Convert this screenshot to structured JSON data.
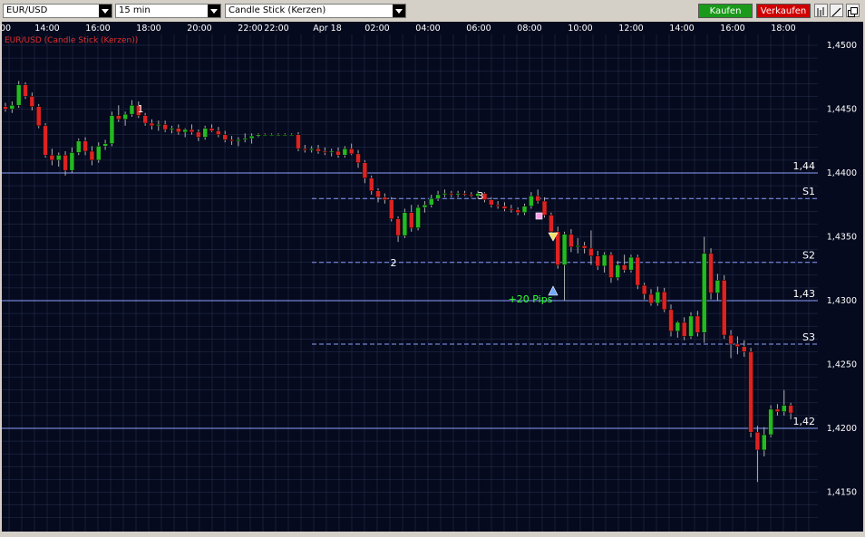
{
  "toolbar": {
    "symbol": "EUR/USD",
    "interval": "15 min",
    "chart_style": "Candle Stick (Kerzen)",
    "buy_label": "Kaufen",
    "sell_label": "Verkaufen",
    "colors": {
      "buy": "#1a9a1a",
      "sell": "#d00000"
    }
  },
  "chart_data": {
    "type": "candlestick",
    "title": "EUR/USD (Candle Stick (Kerzen))",
    "x_tick_labels": [
      "00",
      "14:00",
      "16:00",
      "18:00",
      "20:00",
      "22:00",
      "22:00",
      "Apr 18",
      "02:00",
      "04:00",
      "06:00",
      "08:00",
      "10:00",
      "12:00",
      "14:00",
      "16:00",
      "18:00"
    ],
    "y_tick_labels": [
      "1,4500",
      "1,4450",
      "1,4400",
      "1,4350",
      "1,4300",
      "1,4250",
      "1,4200",
      "1,4150"
    ],
    "ylim": [
      1.413,
      1.452
    ],
    "grid": true,
    "colors": {
      "background": "#050a1e",
      "grid": "#2a3350",
      "up": "#22bb22",
      "down": "#dd2222",
      "level_line": "#8aa0ff",
      "pivot_line": "#8aa0ff",
      "pips_text": "#33ff33"
    },
    "horizontal_levels": [
      {
        "label": "1,44",
        "value": 1.44
      },
      {
        "label": "1,43",
        "value": 1.43
      },
      {
        "label": "1,42",
        "value": 1.42
      }
    ],
    "pivot_levels": [
      {
        "label": "S1",
        "value": 1.438
      },
      {
        "label": "S2",
        "value": 1.433
      },
      {
        "label": "S3",
        "value": 1.4266
      }
    ],
    "annotations": [
      {
        "text": "1",
        "x": "18:00",
        "y": 1.4464
      },
      {
        "text": "2",
        "x": "03:00",
        "y": 1.4343
      },
      {
        "text": "3",
        "x": "06:00",
        "y": 1.4395
      },
      {
        "text": "+20 Pips",
        "x": "09:15",
        "y": 1.4314
      }
    ],
    "candles": [
      [
        1.4452,
        1.4455,
        1.4448,
        1.445
      ],
      [
        1.445,
        1.4456,
        1.4447,
        1.4453
      ],
      [
        1.4453,
        1.4472,
        1.4451,
        1.4469
      ],
      [
        1.4469,
        1.4471,
        1.4458,
        1.446
      ],
      [
        1.446,
        1.4463,
        1.4449,
        1.4452
      ],
      [
        1.4452,
        1.4454,
        1.4435,
        1.4437
      ],
      [
        1.4437,
        1.4439,
        1.4412,
        1.4414
      ],
      [
        1.4414,
        1.4419,
        1.4406,
        1.441
      ],
      [
        1.441,
        1.4416,
        1.4405,
        1.4414
      ],
      [
        1.4414,
        1.4417,
        1.4398,
        1.4402
      ],
      [
        1.4402,
        1.442,
        1.44,
        1.4416
      ],
      [
        1.4416,
        1.4427,
        1.4414,
        1.4425
      ],
      [
        1.4425,
        1.4428,
        1.4414,
        1.4417
      ],
      [
        1.4417,
        1.4421,
        1.4406,
        1.441
      ],
      [
        1.441,
        1.4424,
        1.4408,
        1.4421
      ],
      [
        1.4421,
        1.4426,
        1.4418,
        1.4423
      ],
      [
        1.4423,
        1.4448,
        1.4421,
        1.4445
      ],
      [
        1.4445,
        1.4453,
        1.444,
        1.4442
      ],
      [
        1.4442,
        1.4448,
        1.4437,
        1.4446
      ],
      [
        1.4446,
        1.4457,
        1.4444,
        1.4453
      ],
      [
        1.4453,
        1.4456,
        1.4443,
        1.4445
      ],
      [
        1.4445,
        1.4447,
        1.4437,
        1.4439
      ],
      [
        1.4439,
        1.4442,
        1.4434,
        1.4437
      ],
      [
        1.4437,
        1.4441,
        1.4433,
        1.4438
      ],
      [
        1.4438,
        1.4441,
        1.4432,
        1.4434
      ],
      [
        1.4434,
        1.4437,
        1.4431,
        1.4435
      ],
      [
        1.4435,
        1.4438,
        1.443,
        1.4432
      ],
      [
        1.4432,
        1.4435,
        1.4428,
        1.4434
      ],
      [
        1.4434,
        1.4438,
        1.443,
        1.4432
      ],
      [
        1.4432,
        1.4434,
        1.4425,
        1.4428
      ],
      [
        1.4428,
        1.4437,
        1.4426,
        1.4435
      ],
      [
        1.4435,
        1.4438,
        1.4432,
        1.4433
      ],
      [
        1.4433,
        1.4436,
        1.4428,
        1.443
      ],
      [
        1.443,
        1.4433,
        1.4424,
        1.4426
      ],
      [
        1.4426,
        1.4429,
        1.4422,
        1.4425
      ],
      [
        1.4425,
        1.4428,
        1.4421,
        1.4426
      ],
      [
        1.4426,
        1.4431,
        1.4424,
        1.4427
      ],
      [
        1.4427,
        1.4431,
        1.4423,
        1.4429
      ],
      [
        1.4429,
        1.4431,
        1.4428,
        1.443
      ],
      [
        1.443,
        1.4431,
        1.4429,
        1.443
      ],
      [
        1.443,
        1.4431,
        1.4429,
        1.443
      ],
      [
        1.443,
        1.4431,
        1.4429,
        1.443
      ],
      [
        1.443,
        1.4431,
        1.4429,
        1.443
      ],
      [
        1.443,
        1.4431,
        1.4429,
        1.443
      ],
      [
        1.443,
        1.4432,
        1.4417,
        1.4419
      ],
      [
        1.4419,
        1.4422,
        1.4416,
        1.4418
      ],
      [
        1.4418,
        1.4421,
        1.4416,
        1.4419
      ],
      [
        1.4419,
        1.4422,
        1.4415,
        1.4417
      ],
      [
        1.4417,
        1.442,
        1.4414,
        1.4416
      ],
      [
        1.4416,
        1.4419,
        1.4413,
        1.4417
      ],
      [
        1.4417,
        1.442,
        1.4412,
        1.4414
      ],
      [
        1.4414,
        1.4421,
        1.4412,
        1.4419
      ],
      [
        1.4419,
        1.4423,
        1.4414,
        1.4415
      ],
      [
        1.4415,
        1.4418,
        1.4404,
        1.4408
      ],
      [
        1.4408,
        1.441,
        1.4392,
        1.4396
      ],
      [
        1.4396,
        1.4398,
        1.4383,
        1.4386
      ],
      [
        1.4386,
        1.4388,
        1.4377,
        1.4381
      ],
      [
        1.4381,
        1.4384,
        1.4376,
        1.4379
      ],
      [
        1.4379,
        1.4381,
        1.4362,
        1.4364
      ],
      [
        1.4364,
        1.4366,
        1.4346,
        1.4351
      ],
      [
        1.4351,
        1.4372,
        1.4349,
        1.4369
      ],
      [
        1.4369,
        1.4375,
        1.4354,
        1.4357
      ],
      [
        1.4357,
        1.4375,
        1.4355,
        1.4373
      ],
      [
        1.4373,
        1.4378,
        1.4369,
        1.4375
      ],
      [
        1.4375,
        1.4383,
        1.4373,
        1.438
      ],
      [
        1.438,
        1.4386,
        1.4378,
        1.4383
      ],
      [
        1.4383,
        1.4387,
        1.4381,
        1.4384
      ],
      [
        1.4384,
        1.4386,
        1.4381,
        1.4383
      ],
      [
        1.4383,
        1.4386,
        1.4381,
        1.4384
      ],
      [
        1.4384,
        1.4386,
        1.4382,
        1.4383
      ],
      [
        1.4383,
        1.4385,
        1.4381,
        1.4382
      ],
      [
        1.4382,
        1.4386,
        1.438,
        1.4384
      ],
      [
        1.4384,
        1.4385,
        1.4377,
        1.4379
      ],
      [
        1.4379,
        1.4381,
        1.4373,
        1.4375
      ],
      [
        1.4375,
        1.4378,
        1.4372,
        1.4374
      ],
      [
        1.4374,
        1.4377,
        1.437,
        1.4372
      ],
      [
        1.4372,
        1.4375,
        1.4369,
        1.4371
      ],
      [
        1.4371,
        1.4373,
        1.4367,
        1.4369
      ],
      [
        1.4369,
        1.4376,
        1.4367,
        1.4374
      ],
      [
        1.4374,
        1.4385,
        1.4372,
        1.4382
      ],
      [
        1.4382,
        1.4387,
        1.4376,
        1.4378
      ],
      [
        1.4378,
        1.4381,
        1.4365,
        1.4367
      ],
      [
        1.4367,
        1.4369,
        1.4352,
        1.4354
      ],
      [
        1.4354,
        1.4358,
        1.4325,
        1.4328
      ],
      [
        1.4328,
        1.4354,
        1.43,
        1.4352
      ],
      [
        1.4352,
        1.4356,
        1.4338,
        1.4342
      ],
      [
        1.4342,
        1.4349,
        1.4337,
        1.4343
      ],
      [
        1.4343,
        1.4346,
        1.4337,
        1.4341
      ],
      [
        1.4341,
        1.4355,
        1.4328,
        1.4335
      ],
      [
        1.4335,
        1.4339,
        1.4324,
        1.4327
      ],
      [
        1.4327,
        1.4338,
        1.4322,
        1.4336
      ],
      [
        1.4336,
        1.4338,
        1.4314,
        1.4318
      ],
      [
        1.4318,
        1.4331,
        1.4316,
        1.4328
      ],
      [
        1.4328,
        1.4336,
        1.4322,
        1.4324
      ],
      [
        1.4324,
        1.4336,
        1.4322,
        1.4334
      ],
      [
        1.4334,
        1.4336,
        1.4309,
        1.4312
      ],
      [
        1.4312,
        1.4314,
        1.4301,
        1.4305
      ],
      [
        1.4305,
        1.4309,
        1.4296,
        1.4298
      ],
      [
        1.4298,
        1.4311,
        1.4296,
        1.4307
      ],
      [
        1.4307,
        1.431,
        1.4291,
        1.4293
      ],
      [
        1.4293,
        1.4297,
        1.4272,
        1.4276
      ],
      [
        1.4276,
        1.4284,
        1.4271,
        1.4283
      ],
      [
        1.4283,
        1.4287,
        1.4269,
        1.4272
      ],
      [
        1.4272,
        1.4291,
        1.427,
        1.4288
      ],
      [
        1.4288,
        1.4292,
        1.4272,
        1.4275
      ],
      [
        1.4275,
        1.435,
        1.4267,
        1.4337
      ],
      [
        1.4337,
        1.4341,
        1.4301,
        1.4306
      ],
      [
        1.4306,
        1.4321,
        1.43,
        1.4316
      ],
      [
        1.4316,
        1.432,
        1.427,
        1.4273
      ],
      [
        1.4273,
        1.4277,
        1.4255,
        1.4266
      ],
      [
        1.4266,
        1.4272,
        1.4258,
        1.4264
      ],
      [
        1.4264,
        1.4269,
        1.4256,
        1.426
      ],
      [
        1.426,
        1.4263,
        1.4193,
        1.4197
      ],
      [
        1.4197,
        1.4202,
        1.4158,
        1.4183
      ],
      [
        1.4183,
        1.4201,
        1.4178,
        1.4195
      ],
      [
        1.4195,
        1.4218,
        1.4193,
        1.4215
      ],
      [
        1.4215,
        1.4219,
        1.421,
        1.4213
      ],
      [
        1.4213,
        1.423,
        1.421,
        1.4218
      ],
      [
        1.4218,
        1.422,
        1.4207,
        1.4212
      ]
    ]
  }
}
